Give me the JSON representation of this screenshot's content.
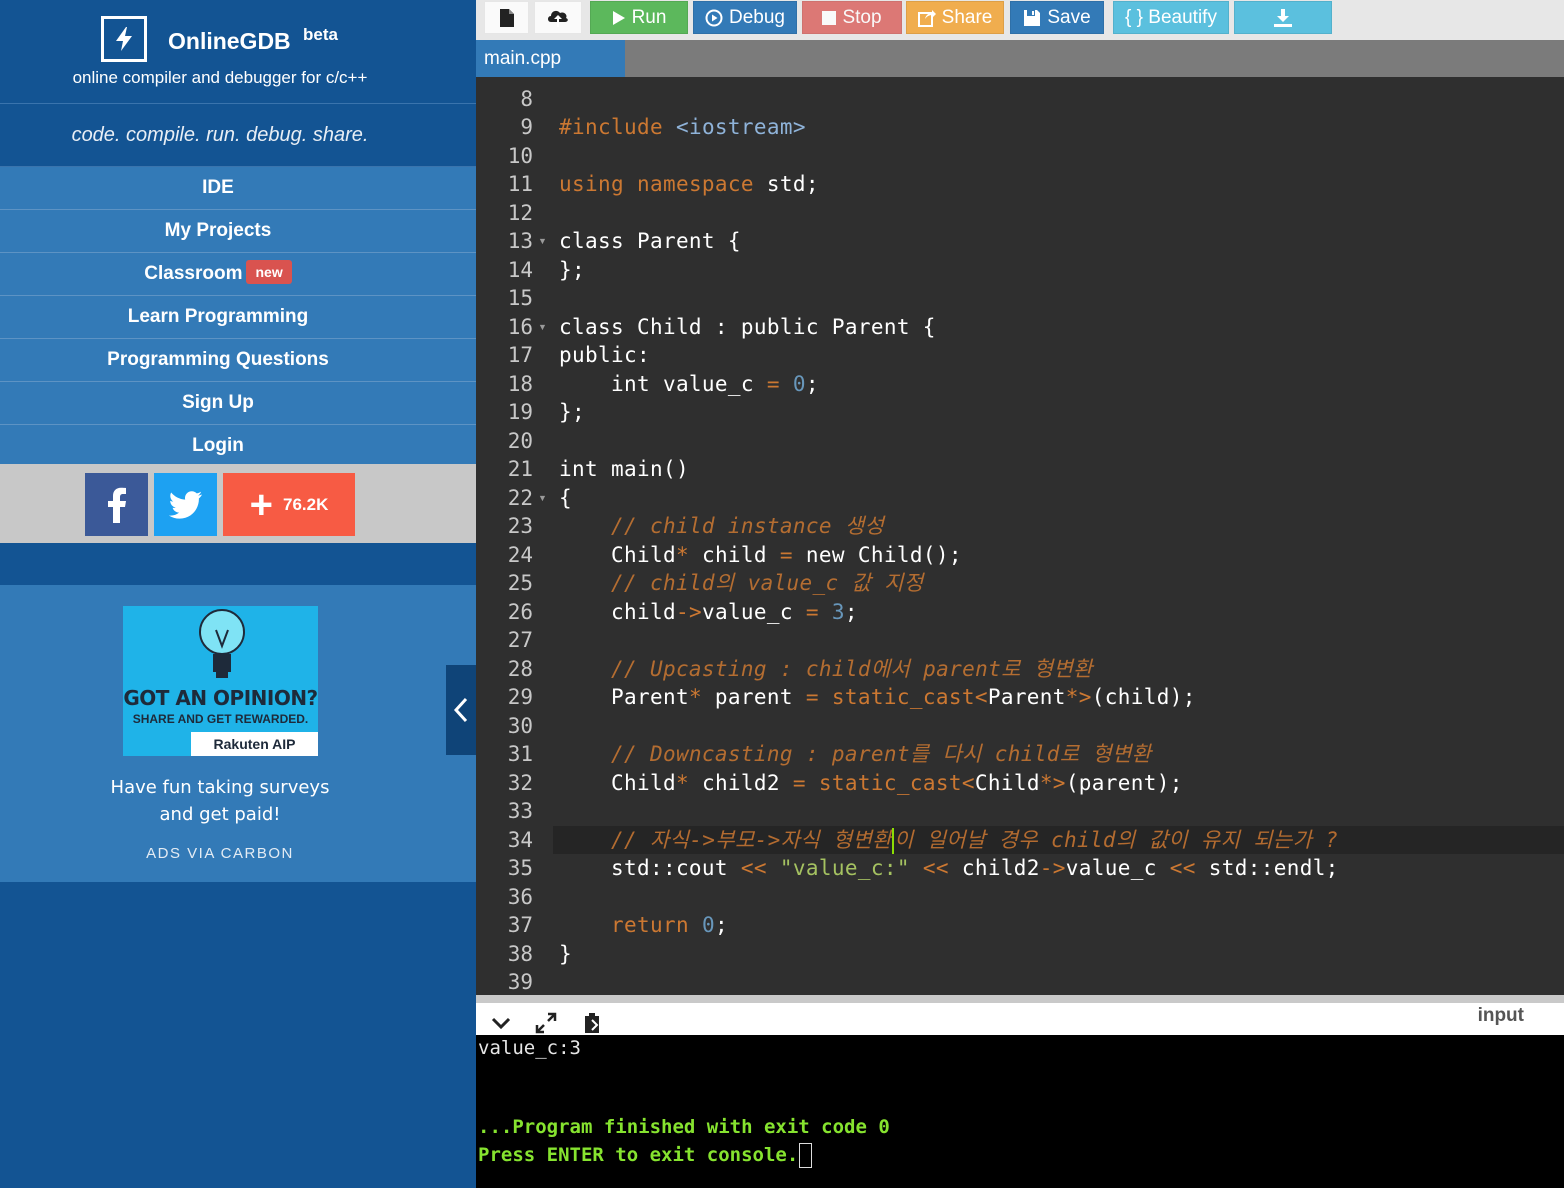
{
  "brand": {
    "title": "OnlineGDB",
    "beta": "beta",
    "subtitle": "online compiler and debugger for c/c++",
    "tagline": "code. compile. run. debug. share."
  },
  "nav": {
    "items": [
      {
        "label": "IDE"
      },
      {
        "label": "My Projects"
      },
      {
        "label": "Classroom",
        "badge": "new"
      },
      {
        "label": "Learn Programming"
      },
      {
        "label": "Programming Questions"
      },
      {
        "label": "Sign Up"
      },
      {
        "label": "Login"
      }
    ]
  },
  "social": {
    "share_count": "76.2K"
  },
  "ad": {
    "headline": "GOT AN OPINION?",
    "subheadline": "SHARE AND GET REWARDED.",
    "brand": "Rakuten AIP",
    "text_line1": "Have fun taking surveys",
    "text_line2": "and get paid!",
    "via": "ADS VIA CARBON"
  },
  "toolbar": {
    "run": "Run",
    "debug": "Debug",
    "stop": "Stop",
    "share": "Share",
    "save": "Save",
    "beautify": "{ } Beautify"
  },
  "editor": {
    "tab": "main.cpp",
    "lines": [
      {
        "n": "8"
      },
      {
        "n": "9"
      },
      {
        "n": "10"
      },
      {
        "n": "11"
      },
      {
        "n": "12"
      },
      {
        "n": "13"
      },
      {
        "n": "14"
      },
      {
        "n": "15"
      },
      {
        "n": "16"
      },
      {
        "n": "17"
      },
      {
        "n": "18"
      },
      {
        "n": "19"
      },
      {
        "n": "20"
      },
      {
        "n": "21"
      },
      {
        "n": "22"
      },
      {
        "n": "23"
      },
      {
        "n": "24"
      },
      {
        "n": "25"
      },
      {
        "n": "26"
      },
      {
        "n": "27"
      },
      {
        "n": "28"
      },
      {
        "n": "29"
      },
      {
        "n": "30"
      },
      {
        "n": "31"
      },
      {
        "n": "32"
      },
      {
        "n": "33"
      },
      {
        "n": "34"
      },
      {
        "n": "35"
      },
      {
        "n": "36"
      },
      {
        "n": "37"
      },
      {
        "n": "38"
      },
      {
        "n": "39"
      }
    ],
    "code": {
      "l9a": "#include ",
      "l9b": "<iostream>",
      "l11a": "using",
      "l11b": " ",
      "l11c": "namespace",
      "l11d": " std;",
      "l13": "class Parent {",
      "l14": "};",
      "l16": "class Child : public Parent {",
      "l17": "public:",
      "l18a": "    int value_c ",
      "l18b": "=",
      "l18c": " ",
      "l18d": "0",
      "l18e": ";",
      "l19": "};",
      "l21": "int main()",
      "l22": "{",
      "l23": "    // child instance 생성",
      "l24a": "    Child",
      "l24b": "*",
      "l24c": " child ",
      "l24d": "=",
      "l24e": " new Child();",
      "l25": "    // child의 value_c 값 지정",
      "l26a": "    child",
      "l26b": "->",
      "l26c": "value_c ",
      "l26d": "=",
      "l26e": " ",
      "l26f": "3",
      "l26g": ";",
      "l28": "    // Upcasting : child에서 parent로 형변환",
      "l29a": "    Parent",
      "l29b": "*",
      "l29c": " parent ",
      "l29d": "=",
      "l29e": " ",
      "l29f": "static_cast",
      "l29g": "<",
      "l29h": "Parent",
      "l29i": "*>",
      "l29j": "(child);",
      "l31": "    // Downcasting : parent를 다시 child로 형변환",
      "l32a": "    Child",
      "l32b": "*",
      "l32c": " child2 ",
      "l32d": "=",
      "l32e": " ",
      "l32f": "static_cast",
      "l32g": "<",
      "l32h": "Child",
      "l32i": "*>",
      "l32j": "(parent);",
      "l34a": "    // 자식->부모->자식 형변환",
      "l34b": "이 일어날 경우 child의 값이 유지 되는가 ?",
      "l35a": "    std::cout ",
      "l35b": "<<",
      "l35c": " ",
      "l35d": "\"value_c:\"",
      "l35e": " ",
      "l35f": "<<",
      "l35g": " child2",
      "l35h": "->",
      "l35i": "value_c ",
      "l35j": "<<",
      "l35k": " std::endl;",
      "l37a": "    ",
      "l37b": "return",
      "l37c": " ",
      "l37d": "0",
      "l37e": ";",
      "l38": "}"
    }
  },
  "console": {
    "input_label": "input",
    "output": "value_c:3",
    "finished": "...Program finished with exit code 0",
    "press": "Press ENTER to exit console."
  },
  "colors": {
    "sidebar": "#135493",
    "nav": "#337ab7",
    "editor_bg": "#2f2f2f",
    "keyword": "#cc7832",
    "number": "#6897bb",
    "string": "#a5c261",
    "console_green": "#86e32f"
  },
  "icons": {
    "logo": "lightning-bolt-icon",
    "new_file": "file-icon",
    "upload": "upload-cloud-icon",
    "run": "play-icon",
    "debug": "play-circle-icon",
    "stop": "stop-square-icon",
    "share": "share-icon",
    "save": "floppy-disk-icon",
    "download": "download-icon",
    "collapse": "chevron-left-icon",
    "console_toggle": "chevron-down-icon",
    "expand": "expand-icon",
    "copy": "clipboard-icon"
  }
}
